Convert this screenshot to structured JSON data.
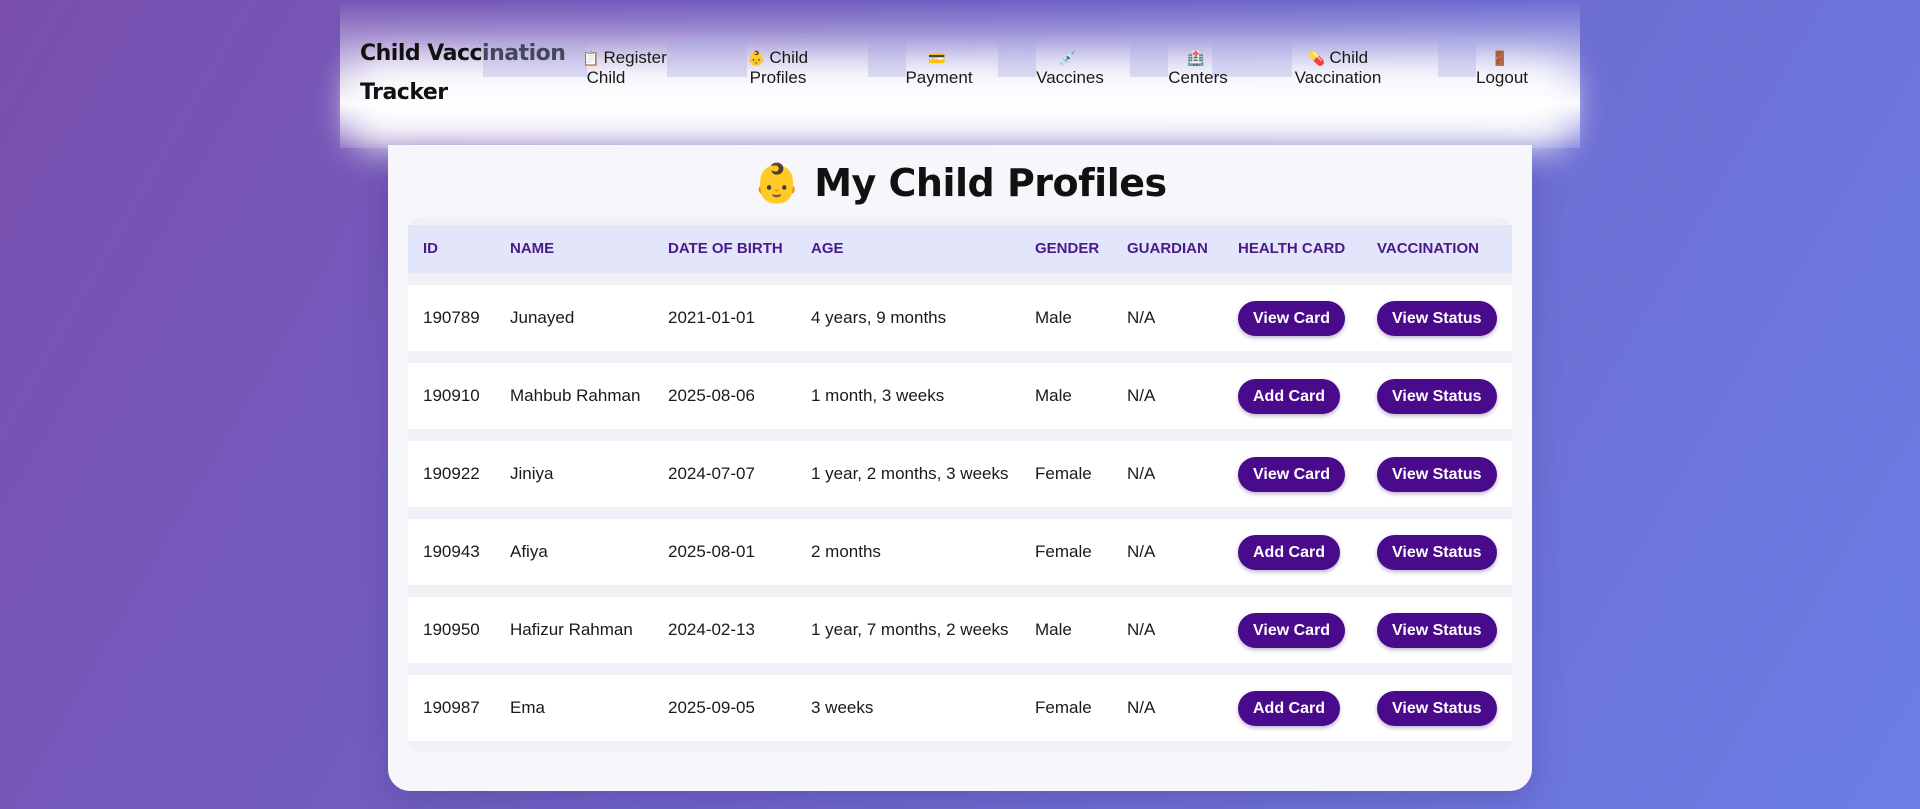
{
  "app": {
    "brand": "Child Vaccination Tracker"
  },
  "nav": [
    {
      "icon": "📋",
      "label": "Register",
      "label2": "Child"
    },
    {
      "icon": "👶",
      "label": "Child",
      "label2": "Profiles"
    },
    {
      "icon": "💳",
      "label": "",
      "label2": "Payment"
    },
    {
      "icon": "💉",
      "label": "",
      "label2": "Vaccines"
    },
    {
      "icon": "🏥",
      "label": "",
      "label2": "Centers"
    },
    {
      "icon": "💊",
      "label": "Child",
      "label2": "Vaccination"
    },
    {
      "icon": "🚪",
      "label": "",
      "label2": "Logout"
    }
  ],
  "page": {
    "emoji": "👶",
    "title": "My Child Profiles"
  },
  "table": {
    "headers": [
      "ID",
      "NAME",
      "DATE OF BIRTH",
      "AGE",
      "GENDER",
      "GUARDIAN",
      "HEALTH CARD",
      "VACCINATION"
    ],
    "rows": [
      {
        "id": "190789",
        "name": "Junayed",
        "dob": "2021-01-01",
        "age": "4 years, 9 months",
        "gender": "Male",
        "guardian": "N/A",
        "card_btn": "View Card",
        "status_btn": "View Status"
      },
      {
        "id": "190910",
        "name": "Mahbub Rahman",
        "dob": "2025-08-06",
        "age": "1 month, 3 weeks",
        "gender": "Male",
        "guardian": "N/A",
        "card_btn": "Add Card",
        "status_btn": "View Status"
      },
      {
        "id": "190922",
        "name": "Jiniya",
        "dob": "2024-07-07",
        "age": "1 year, 2 months, 3 weeks",
        "gender": "Female",
        "guardian": "N/A",
        "card_btn": "View Card",
        "status_btn": "View Status"
      },
      {
        "id": "190943",
        "name": "Afiya",
        "dob": "2025-08-01",
        "age": "2 months",
        "gender": "Female",
        "guardian": "N/A",
        "card_btn": "Add Card",
        "status_btn": "View Status"
      },
      {
        "id": "190950",
        "name": "Hafizur Rahman",
        "dob": "2024-02-13",
        "age": "1 year, 7 months, 2 weeks",
        "gender": "Male",
        "guardian": "N/A",
        "card_btn": "View Card",
        "status_btn": "View Status"
      },
      {
        "id": "190987",
        "name": "Ema",
        "dob": "2025-09-05",
        "age": "3 weeks",
        "gender": "Female",
        "guardian": "N/A",
        "card_btn": "Add Card",
        "status_btn": "View Status"
      }
    ]
  },
  "colors": {
    "accent": "#4a0a8c",
    "header_bg": "#e3e6fb",
    "header_text": "#4b1a8a"
  }
}
